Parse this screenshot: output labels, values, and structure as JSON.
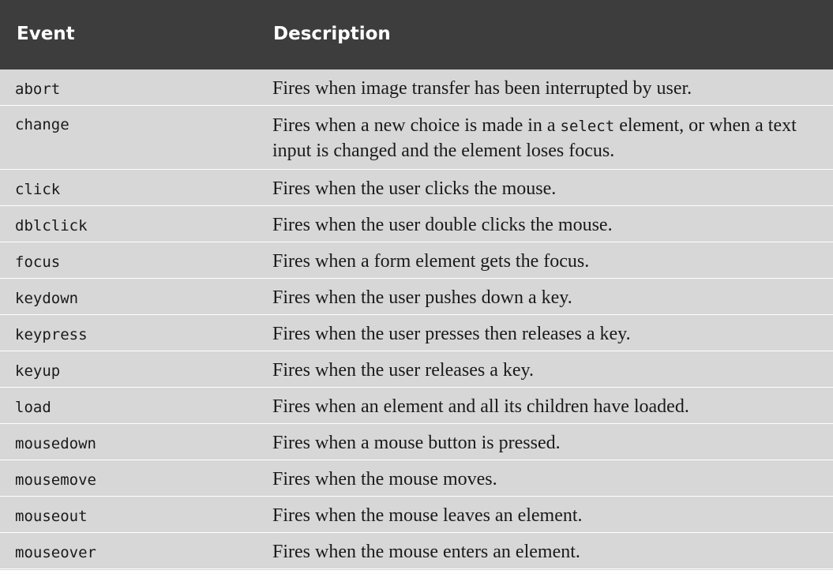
{
  "table": {
    "headers": {
      "event": "Event",
      "description": "Description"
    },
    "rows": [
      {
        "event": "abort",
        "description": "Fires when image transfer has been interrupted by user."
      },
      {
        "event": "change",
        "description_before": "Fires when a new choice is made in a ",
        "description_code": "select",
        "description_after": " element, or when a text input is changed and the element loses focus."
      },
      {
        "event": "click",
        "description": "Fires when the user clicks the mouse."
      },
      {
        "event": "dblclick",
        "description": "Fires when the user double clicks the mouse."
      },
      {
        "event": "focus",
        "description": "Fires when a form element gets the focus."
      },
      {
        "event": "keydown",
        "description": "Fires when the user pushes down a key."
      },
      {
        "event": "keypress",
        "description": "Fires when the user presses then releases a key."
      },
      {
        "event": "keyup",
        "description": "Fires when the user releases a key."
      },
      {
        "event": "load",
        "description": "Fires when an element and all its children have loaded."
      },
      {
        "event": "mousedown",
        "description": "Fires when a mouse button is pressed."
      },
      {
        "event": "mousemove",
        "description": "Fires when the mouse moves."
      },
      {
        "event": "mouseout",
        "description": "Fires when the mouse leaves an element."
      },
      {
        "event": "mouseover",
        "description": "Fires when the mouse enters an element."
      }
    ]
  },
  "colors": {
    "header_bg": "#3d3d3d",
    "body_bg": "#d7d7d7",
    "text": "#1a1a1a"
  }
}
